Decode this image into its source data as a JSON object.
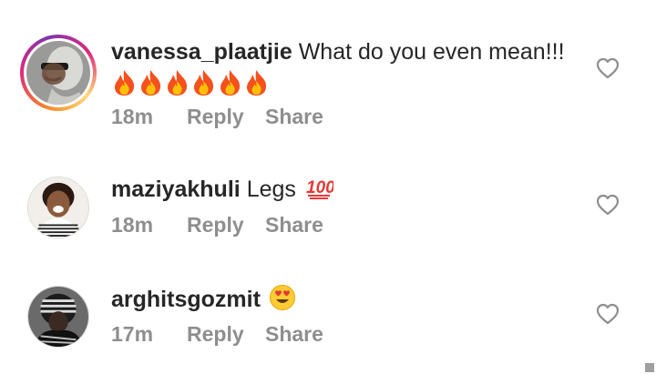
{
  "comments": [
    {
      "username": "vanessa_plaatjie",
      "text": "What do you even mean!!!",
      "emoji": [
        "fire-icon",
        "fire-icon",
        "fire-icon",
        "fire-icon",
        "fire-icon",
        "fire-icon"
      ],
      "time": "18m",
      "reply_label": "Reply",
      "share_label": "Share",
      "has_story_ring": true
    },
    {
      "username": "maziyakhuli",
      "text": "Legs",
      "emoji": [
        "hundred-points-icon"
      ],
      "time": "18m",
      "reply_label": "Reply",
      "share_label": "Share",
      "has_story_ring": false
    },
    {
      "username": "arghitsgozmit",
      "text": "",
      "emoji": [
        "heart-eyes-icon"
      ],
      "time": "17m",
      "reply_label": "Reply",
      "share_label": "Share",
      "has_story_ring": false
    }
  ],
  "colors": {
    "text": "#262626",
    "meta": "#8e8e8e",
    "fire": "#f4511e",
    "hundred": "#e53935",
    "emoji_face": "#ffcc33"
  }
}
